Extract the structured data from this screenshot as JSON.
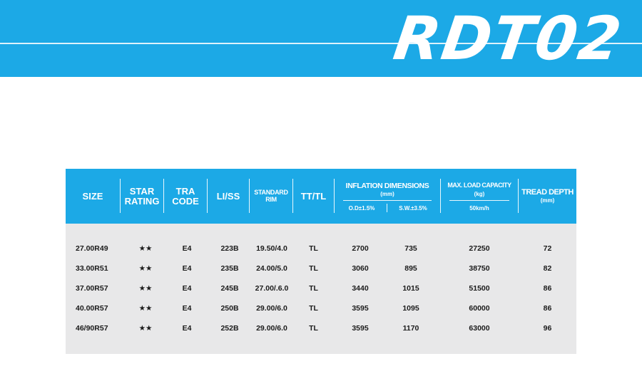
{
  "banner": {
    "model": "RDT02",
    "color": "#1ca9e6"
  },
  "table": {
    "headers": {
      "size": "SIZE",
      "star_rating": [
        "STAR",
        "RATING"
      ],
      "tra_code": [
        "TRA",
        "CODE"
      ],
      "li_ss": "LI/SS",
      "standard_rim": [
        "STANDARD",
        "RIM"
      ],
      "tt_tl": "TT/TL",
      "inflation_dimensions": {
        "title": "INFLATION DIMENSIONS",
        "unit": "(mm)",
        "od": "O.D±1.5%",
        "sw": "S.W.±3.5%"
      },
      "max_load": {
        "title": "MAX. LOAD CAPACITY",
        "unit": "(kg)",
        "speed": "50km/h"
      },
      "tread_depth": {
        "title": "TREAD DEPTH",
        "unit": "(mm)"
      }
    },
    "rows": [
      {
        "size": "27.00R49",
        "star": "★★",
        "tra": "E4",
        "li": "223B",
        "rim": "19.50/4.0",
        "tt": "TL",
        "od": "2700",
        "sw": "735",
        "load": "27250",
        "tread": "72"
      },
      {
        "size": "33.00R51",
        "star": "★★",
        "tra": "E4",
        "li": "235B",
        "rim": "24.00/5.0",
        "tt": "TL",
        "od": "3060",
        "sw": "895",
        "load": "38750",
        "tread": "82"
      },
      {
        "size": "37.00R57",
        "star": "★★",
        "tra": "E4",
        "li": "245B",
        "rim": "27.00/.6.0",
        "tt": "TL",
        "od": "3440",
        "sw": "1015",
        "load": "51500",
        "tread": "86"
      },
      {
        "size": "40.00R57",
        "star": "★★",
        "tra": "E4",
        "li": "250B",
        "rim": "29.00/6.0",
        "tt": "TL",
        "od": "3595",
        "sw": "1095",
        "load": "60000",
        "tread": "86"
      },
      {
        "size": "46/90R57",
        "star": "★★",
        "tra": "E4",
        "li": "252B",
        "rim": "29.00/6.0",
        "tt": "TL",
        "od": "3595",
        "sw": "1170",
        "load": "63000",
        "tread": "96"
      }
    ]
  }
}
